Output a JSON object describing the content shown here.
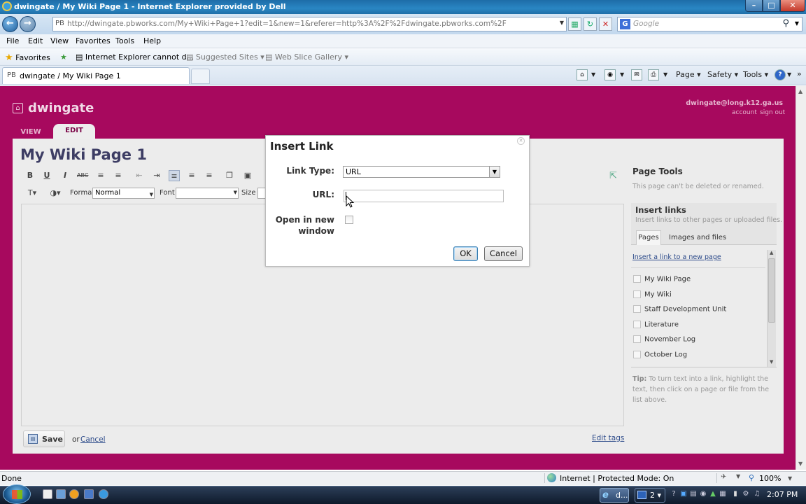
{
  "window": {
    "title": "dwingate / My Wiki Page 1 - Internet Explorer provided by Dell",
    "min": "–",
    "max": "□",
    "close": "✕"
  },
  "addressbar": {
    "favicon": "PB",
    "url": "http://dwingate.pbworks.com/My+Wiki+Page+1?edit=1&new=1&referer=http%3A%2F%2Fdwingate.pbworks.com%2F",
    "search_placeholder": "Google",
    "search_logo": "G"
  },
  "menubar": [
    "File",
    "Edit",
    "View",
    "Favorites",
    "Tools",
    "Help"
  ],
  "favorites_bar": {
    "favorites": "Favorites",
    "items": [
      "Internet Explorer cannot d...",
      "Suggested Sites",
      "Web Slice Gallery"
    ]
  },
  "tabs": {
    "active_favicon": "PB",
    "active_title": "dwingate / My Wiki Page 1"
  },
  "commandbar": {
    "page": "Page",
    "safety": "Safety",
    "tools": "Tools"
  },
  "site": {
    "name": "dwingate",
    "user_email": "dwingate@long.k12.ga.us",
    "account": "account",
    "sign_out": "sign out",
    "tab_view": "VIEW",
    "tab_edit": "EDIT"
  },
  "editor": {
    "page_title": "My Wiki Page 1",
    "format_label": "Format",
    "format_value": "Normal",
    "font_label": "Font",
    "size_label": "Size",
    "save": "Save",
    "or": "or",
    "cancel": "Cancel",
    "edit_tags": "Edit tags"
  },
  "sidebar": {
    "page_tools_title": "Page Tools",
    "page_tools_note": "This page can't be deleted or renamed.",
    "insert_links_title": "Insert links",
    "insert_links_desc": "Insert links to other pages or uploaded files.",
    "tab_pages": "Pages",
    "tab_images": "Images and files",
    "insert_new_page": "Insert a link to a new page",
    "pages": [
      "My Wiki Page",
      "My Wiki",
      "Staff Development Unit",
      "Literature",
      "November Log",
      "October Log"
    ],
    "tip_label": "Tip:",
    "tip_text": "To turn text into a link, highlight the text, then click on a page or file from the list above."
  },
  "dialog": {
    "title": "Insert Link",
    "link_type_label": "Link Type:",
    "link_type_value": "URL",
    "url_label": "URL:",
    "url_value": "",
    "new_window_label_1": "Open in new",
    "new_window_label_2": "window",
    "new_window_checked": false,
    "ok": "OK",
    "cancel": "Cancel"
  },
  "statusbar": {
    "status": "Done",
    "zone": "Internet | Protected Mode: On",
    "zoom": "100%"
  },
  "taskbar": {
    "ie_task": "d...",
    "group_count": "2",
    "clock": "2:07 PM"
  }
}
